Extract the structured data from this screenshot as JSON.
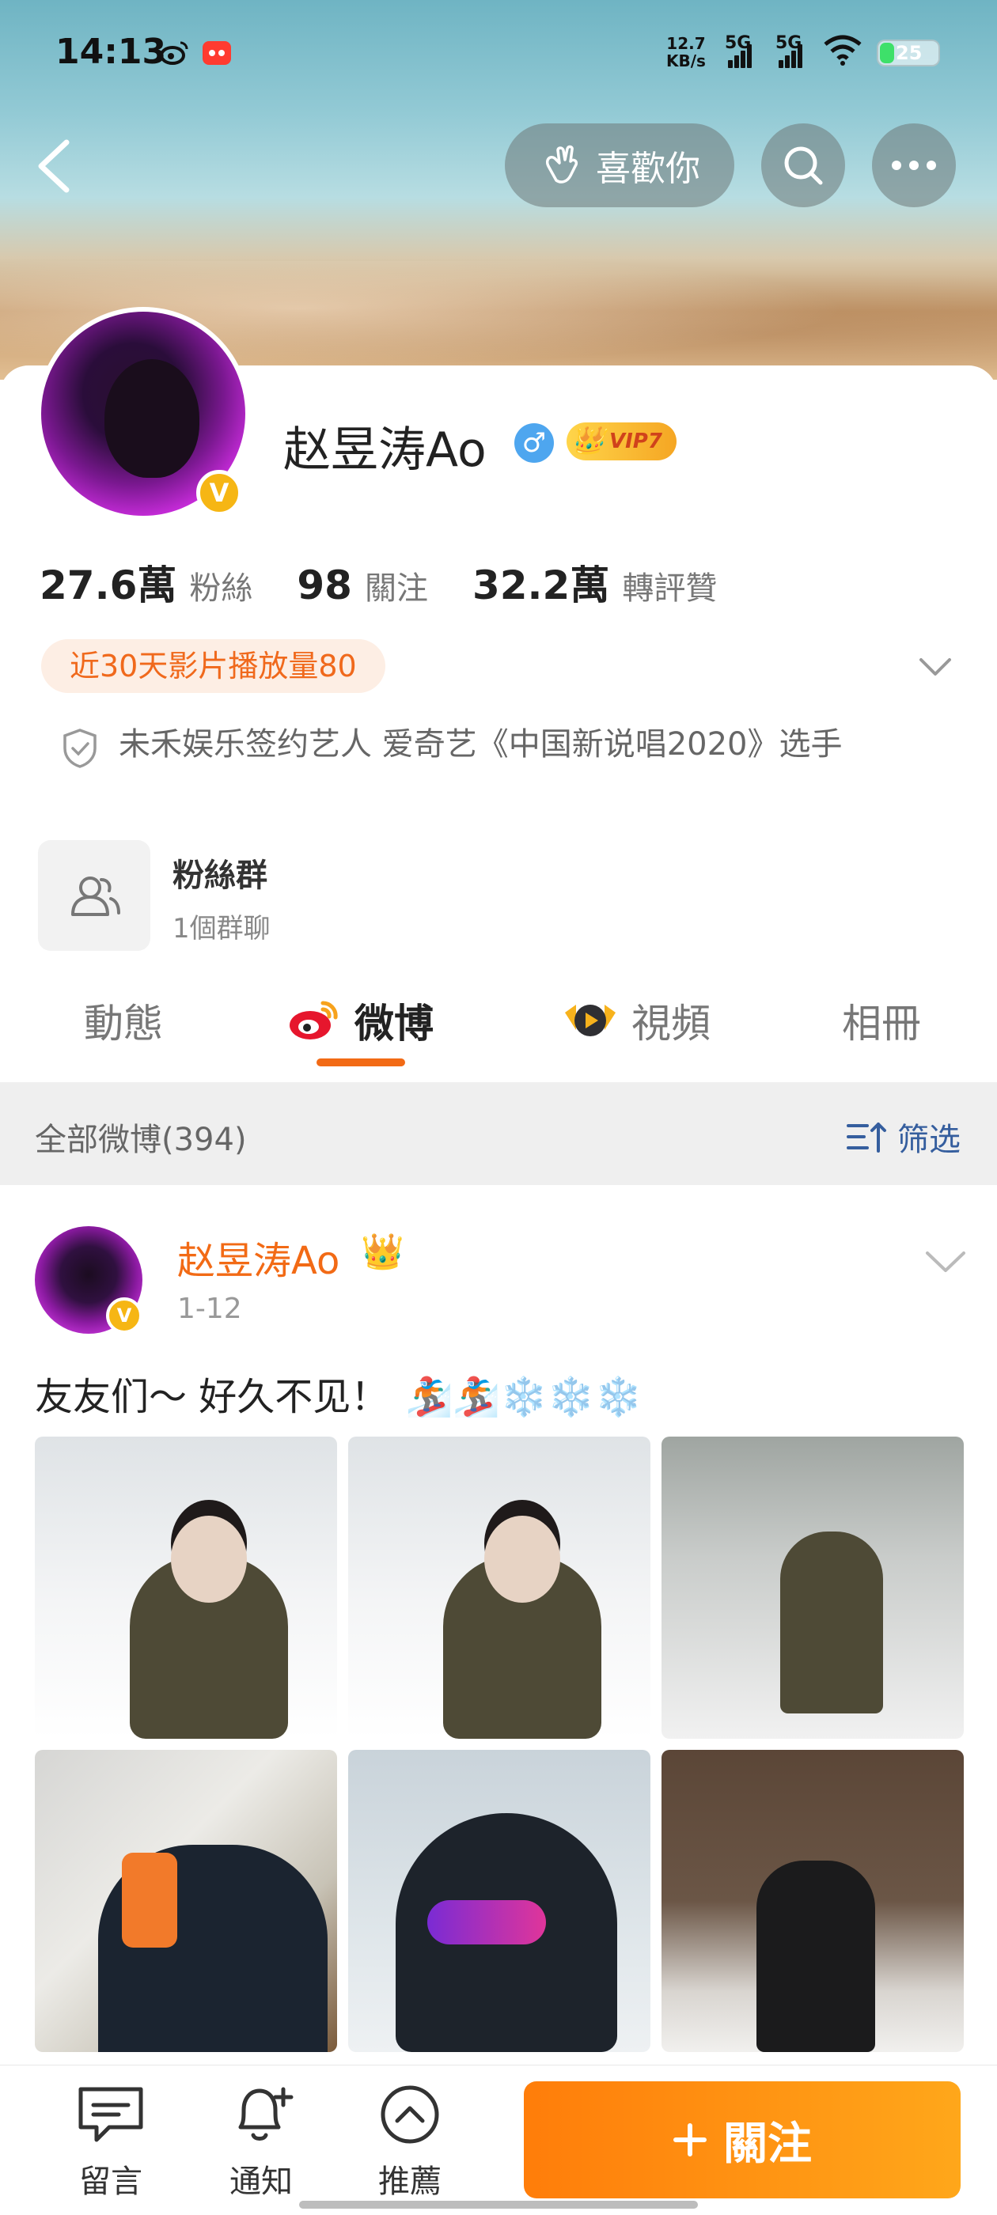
{
  "status": {
    "time": "14:13",
    "speed_top": "12.7",
    "speed_bottom": "KB/s",
    "net1": "5G",
    "net2": "5G",
    "battery": "25"
  },
  "header": {
    "like_label": "喜歡你"
  },
  "profile": {
    "name": "赵昱涛Ao",
    "vip_label": "VIP7",
    "verified": "V",
    "stats": [
      {
        "value": "27.6萬",
        "label": "粉絲"
      },
      {
        "value": "98",
        "label": "關注"
      },
      {
        "value": "32.2萬",
        "label": "轉評贊"
      }
    ],
    "play_badge": "近30天影片播放量80",
    "bio": "未禾娱乐签约艺人 爱奇艺《中国新说唱2020》选手",
    "fan_group": {
      "title": "粉絲群",
      "subtitle": "1個群聊"
    }
  },
  "tabs": [
    {
      "label": "動態"
    },
    {
      "label": "微博"
    },
    {
      "label": "視頻"
    },
    {
      "label": "相冊"
    }
  ],
  "filter": {
    "left_label": "全部微博(394)",
    "right_label": "筛选"
  },
  "post": {
    "author": "赵昱涛Ao",
    "date": "1-12",
    "text": "友友们～ 好久不见！",
    "emojis": "🏂🏂❄️❄️❄️"
  },
  "bottom": {
    "comment_label": "留言",
    "notify_label": "通知",
    "recommend_label": "推薦",
    "follow_label": "關注"
  },
  "colors": {
    "accent": "#f26a15",
    "follow_start": "#ff7d0a",
    "follow_end": "#ffa71a",
    "link": "#355e9e"
  }
}
